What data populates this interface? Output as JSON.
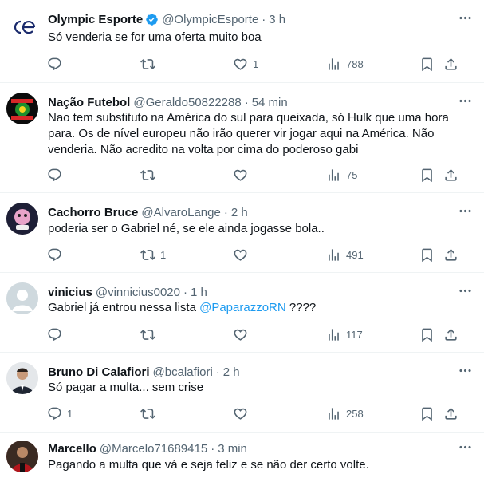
{
  "tweets": [
    {
      "name": "Olympic Esporte",
      "handle": "@OlympicEsporte",
      "time": "3 h",
      "verified": true,
      "text": "Só venderia se for uma oferta muito boa",
      "replies": "",
      "retweets": "",
      "likes": "1",
      "views": "788"
    },
    {
      "name": "Nação Futebol",
      "handle": "@Geraldo50822288",
      "time": "54 min",
      "text": "Nao tem substituto na América do sul para queixada, só Hulk que uma hora para. Os de nível europeu não irão querer vir jogar aqui na América. Não venderia. Não acredito na volta por cima do poderoso gabi",
      "replies": "",
      "retweets": "",
      "likes": "",
      "views": "75"
    },
    {
      "name": "Cachorro Bruce",
      "handle": "@AlvaroLange",
      "time": "2 h",
      "text": "poderia ser o Gabriel né, se ele ainda jogasse bola..",
      "replies": "",
      "retweets": "1",
      "likes": "",
      "views": "491"
    },
    {
      "name": "vinicius",
      "handle": "@vinnicius0020",
      "time": "1 h",
      "text_before": "Gabriel já entrou nessa lista ",
      "mention": "@PaparazzoRN",
      "text_after": " ????",
      "replies": "",
      "retweets": "",
      "likes": "",
      "views": "117"
    },
    {
      "name": "Bruno Di Calafiori",
      "handle": "@bcalafiori",
      "time": "2 h",
      "text": "Só pagar a multa... sem crise",
      "replies": "1",
      "retweets": "",
      "likes": "",
      "views": "258"
    },
    {
      "name": "Marcello",
      "handle": "@Marcelo71689415",
      "time": "3 min",
      "text": "Pagando a multa que vá e seja feliz e se não der certo volte."
    }
  ],
  "separator": "·",
  "colors": {
    "text": "#0f1419",
    "muted": "#536471",
    "link": "#1d9bf0",
    "border": "#eff3f4"
  },
  "icons": {
    "reply": "reply-icon",
    "retweet": "retweet-icon",
    "like": "heart-icon",
    "views": "views-icon",
    "bookmark": "bookmark-icon",
    "share": "share-icon",
    "more": "more-dots-icon",
    "verified": "verified-badge-icon"
  }
}
